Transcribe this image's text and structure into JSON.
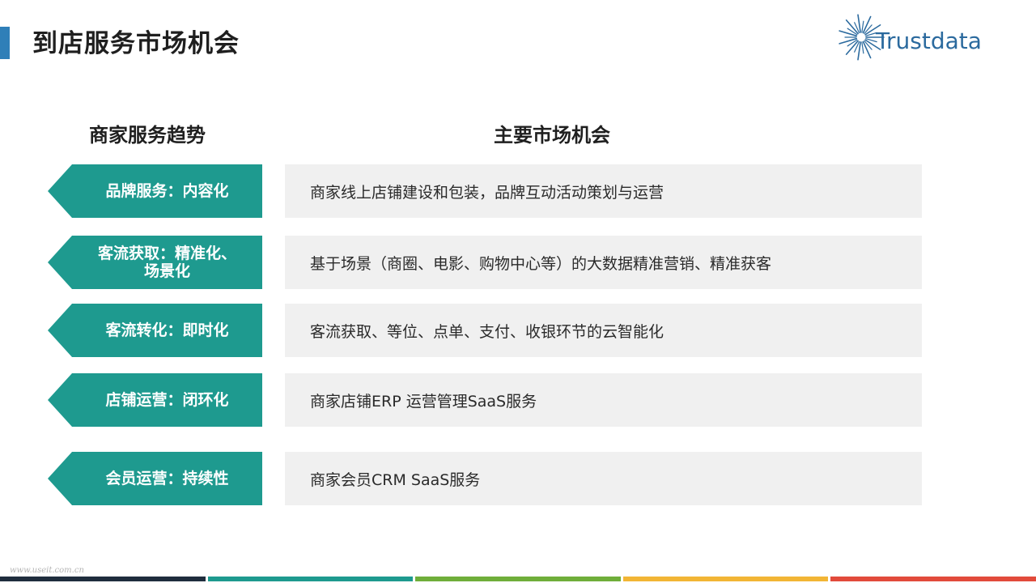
{
  "header": {
    "title": "到店服务市场机会",
    "logo_text": "Trustdata",
    "accent_color": "#2f7fb8"
  },
  "columns": {
    "left_heading": "商家服务趋势",
    "right_heading": "主要市场机会"
  },
  "rows": [
    {
      "tag_lines": [
        "品牌服务：内容化"
      ],
      "opportunity": "商家线上店铺建设和包装，品牌互动活动策划与运营"
    },
    {
      "tag_lines": [
        "客流获取：精准化、",
        "场景化"
      ],
      "opportunity": "基于场景（商圈、电影、购物中心等）的大数据精准营销、精准获客"
    },
    {
      "tag_lines": [
        "客流转化：即时化"
      ],
      "opportunity": "客流获取、等位、点单、支付、收银环节的云智能化"
    },
    {
      "tag_lines": [
        "店铺运营：闭环化"
      ],
      "opportunity": "商家店铺ERP 运营管理SaaS服务"
    },
    {
      "tag_lines": [
        "会员运营：持续性"
      ],
      "opportunity": "商家会员CRM SaaS服务"
    }
  ],
  "colors": {
    "tag_background": "#1e9a8f",
    "panel_background": "#f0f0f0",
    "bottom_strip": [
      "#1f2d3d",
      "#1e9a8f",
      "#6fae3a",
      "#f2b535",
      "#e24b3b"
    ]
  },
  "footer": {
    "watermark": "www.useit.com.cn"
  }
}
